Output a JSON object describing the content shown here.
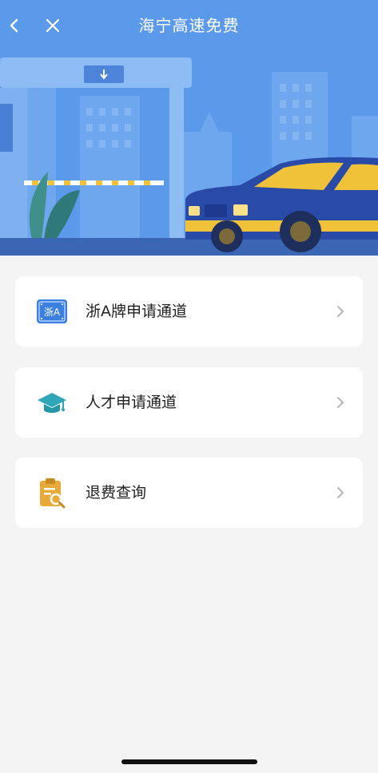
{
  "header": {
    "title": "海宁高速免费",
    "back_icon": "chevron-left-icon",
    "close_icon": "close-icon"
  },
  "menu": {
    "items": [
      {
        "label": "浙A牌申请通道",
        "icon": "zhe-a-plate-icon",
        "plate_text": "浙A",
        "color": "#3b7fe0"
      },
      {
        "label": "人才申请通道",
        "icon": "graduation-cap-icon",
        "color": "#2fa6b6"
      },
      {
        "label": "退费查询",
        "icon": "clipboard-search-icon",
        "color": "#e6a93a"
      }
    ]
  },
  "colors": {
    "banner_sky": "#5a98ea",
    "banner_ground": "#3a66b3",
    "car_body": "#2a4aa8",
    "car_roof": "#f0c23a",
    "background": "#f4f4f4"
  }
}
